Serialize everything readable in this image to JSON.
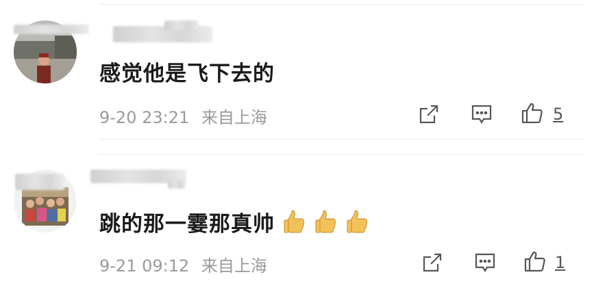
{
  "comments": [
    {
      "text": "感觉他是飞下去的",
      "timestamp": "9-20 23:21",
      "location": "来自上海",
      "likes": "5",
      "emoji_icons": []
    },
    {
      "text": "跳的那一霎那真帅",
      "timestamp": "9-21 09:12",
      "location": "来自上海",
      "likes": "1",
      "emoji_icons": [
        "thumbs-up-emoji",
        "thumbs-up-emoji",
        "thumbs-up-emoji"
      ]
    }
  ],
  "icons": {
    "share": "share-icon",
    "reply": "comment-icon",
    "like": "like-icon"
  },
  "colors": {
    "text": "#1a1a1a",
    "meta": "#9a9a9a",
    "icon": "#555555",
    "divider": "#ececec",
    "emoji": "#f3c15a"
  }
}
